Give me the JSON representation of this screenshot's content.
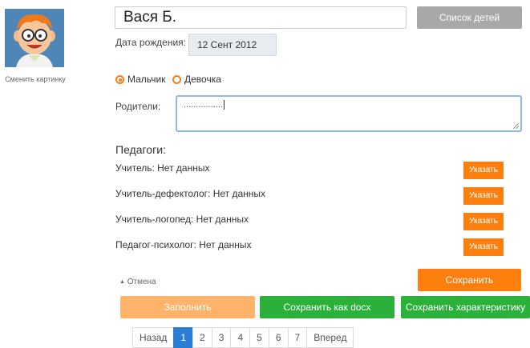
{
  "profile": {
    "change_picture": "Сменить картинку",
    "name": "Вася Б.",
    "kids_list_button": "Список детей",
    "dob_label": "Дата рождения:",
    "dob_value": "12 Сент 2012",
    "gender": {
      "boy": "Мальчик",
      "girl": "Девочка",
      "selected": "boy"
    },
    "parents_label": "Родители:",
    "parents_value": "................"
  },
  "teachers": {
    "title": "Педагоги:",
    "rows": [
      {
        "label": "Учитель: Нет данных",
        "button": "Указать"
      },
      {
        "label": "Учитель-дефектолог: Нет данных",
        "button": "Указать"
      },
      {
        "label": "Учитель-логопед: Нет данных",
        "button": "Указать"
      },
      {
        "label": "Педагог-психолог: Нет данных",
        "button": "Указать"
      }
    ]
  },
  "actions": {
    "cancel": "Отмена",
    "save": "Сохранить",
    "fill": "Заполнить",
    "save_docx": "Сохранить как docx",
    "save_characteristic": "Сохранить характеристику"
  },
  "pagination": {
    "prev": "Назад",
    "pages": [
      "1",
      "2",
      "3",
      "4",
      "5",
      "6",
      "7"
    ],
    "active": "1",
    "next": "Вперед"
  },
  "colors": {
    "accent": "#ff7f0e",
    "green": "#2bb13a",
    "blue": "#2b7ed6"
  }
}
